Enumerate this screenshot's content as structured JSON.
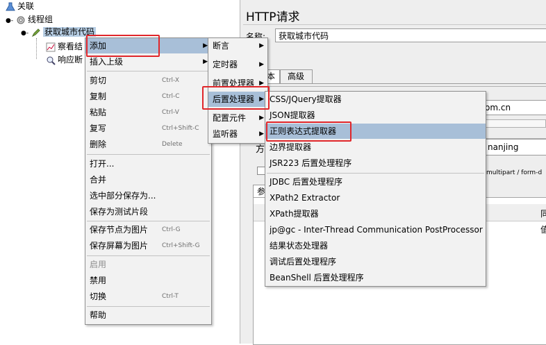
{
  "tree": {
    "root": "关联",
    "thread_group": "线程组",
    "sampler": "获取城市代码",
    "child1": "察看结",
    "child2": "响应断"
  },
  "panel": {
    "title": "HTTP请求",
    "name_label": "名称:",
    "name_value": "获取城市代码",
    "tab_basic": "本",
    "tab_advanced": "高级",
    "server_fragment": "om.cn",
    "path_fragment": "nanjing",
    "method_fragment": "方",
    "multipart_fragment": "用multipart / form-d",
    "params_tab_fragment": "参",
    "col_fragment1": "同",
    "col_fragment2": "值"
  },
  "context_menu": {
    "items": [
      {
        "label": "添加",
        "submenu": true,
        "highlight": true
      },
      {
        "label": "插入上级",
        "submenu": true
      },
      {
        "label": "剪切",
        "shortcut": "Ctrl-X"
      },
      {
        "label": "复制",
        "shortcut": "Ctrl-C"
      },
      {
        "label": "粘贴",
        "shortcut": "Ctrl-V"
      },
      {
        "label": "复写",
        "shortcut": "Ctrl+Shift-C"
      },
      {
        "label": "删除",
        "shortcut": "Delete"
      },
      {
        "label": "打开..."
      },
      {
        "label": "合并"
      },
      {
        "label": "选中部分保存为..."
      },
      {
        "label": "保存为测试片段"
      },
      {
        "label": "保存节点为图片",
        "shortcut": "Ctrl-G"
      },
      {
        "label": "保存屏幕为图片",
        "shortcut": "Ctrl+Shift-G"
      },
      {
        "label": "启用",
        "disabled": true
      },
      {
        "label": "禁用"
      },
      {
        "label": "切换",
        "shortcut": "Ctrl-T"
      },
      {
        "label": "帮助"
      }
    ]
  },
  "add_menu": {
    "items": [
      {
        "label": "断言"
      },
      {
        "label": "定时器"
      },
      {
        "label": "前置处理器"
      },
      {
        "label": "后置处理器",
        "highlight": true
      },
      {
        "label": "配置元件"
      },
      {
        "label": "监听器"
      }
    ]
  },
  "post_menu": {
    "items": [
      {
        "label": "CSS/JQuery提取器"
      },
      {
        "label": "JSON提取器"
      },
      {
        "label": "正则表达式提取器",
        "highlight": true
      },
      {
        "label": "边界提取器"
      },
      {
        "label": "JSR223 后置处理程序"
      },
      {
        "label": "JDBC 后置处理程序"
      },
      {
        "label": "XPath2 Extractor"
      },
      {
        "label": "XPath提取器"
      },
      {
        "label": "jp@gc - Inter-Thread Communication PostProcessor"
      },
      {
        "label": "结果状态处理器"
      },
      {
        "label": "调试后置处理程序"
      },
      {
        "label": "BeanShell 后置处理程序"
      }
    ]
  },
  "colors": {
    "highlight": "#a8bfd8",
    "annotation": "#e0262a",
    "menu_bg": "#f2f2f2"
  }
}
